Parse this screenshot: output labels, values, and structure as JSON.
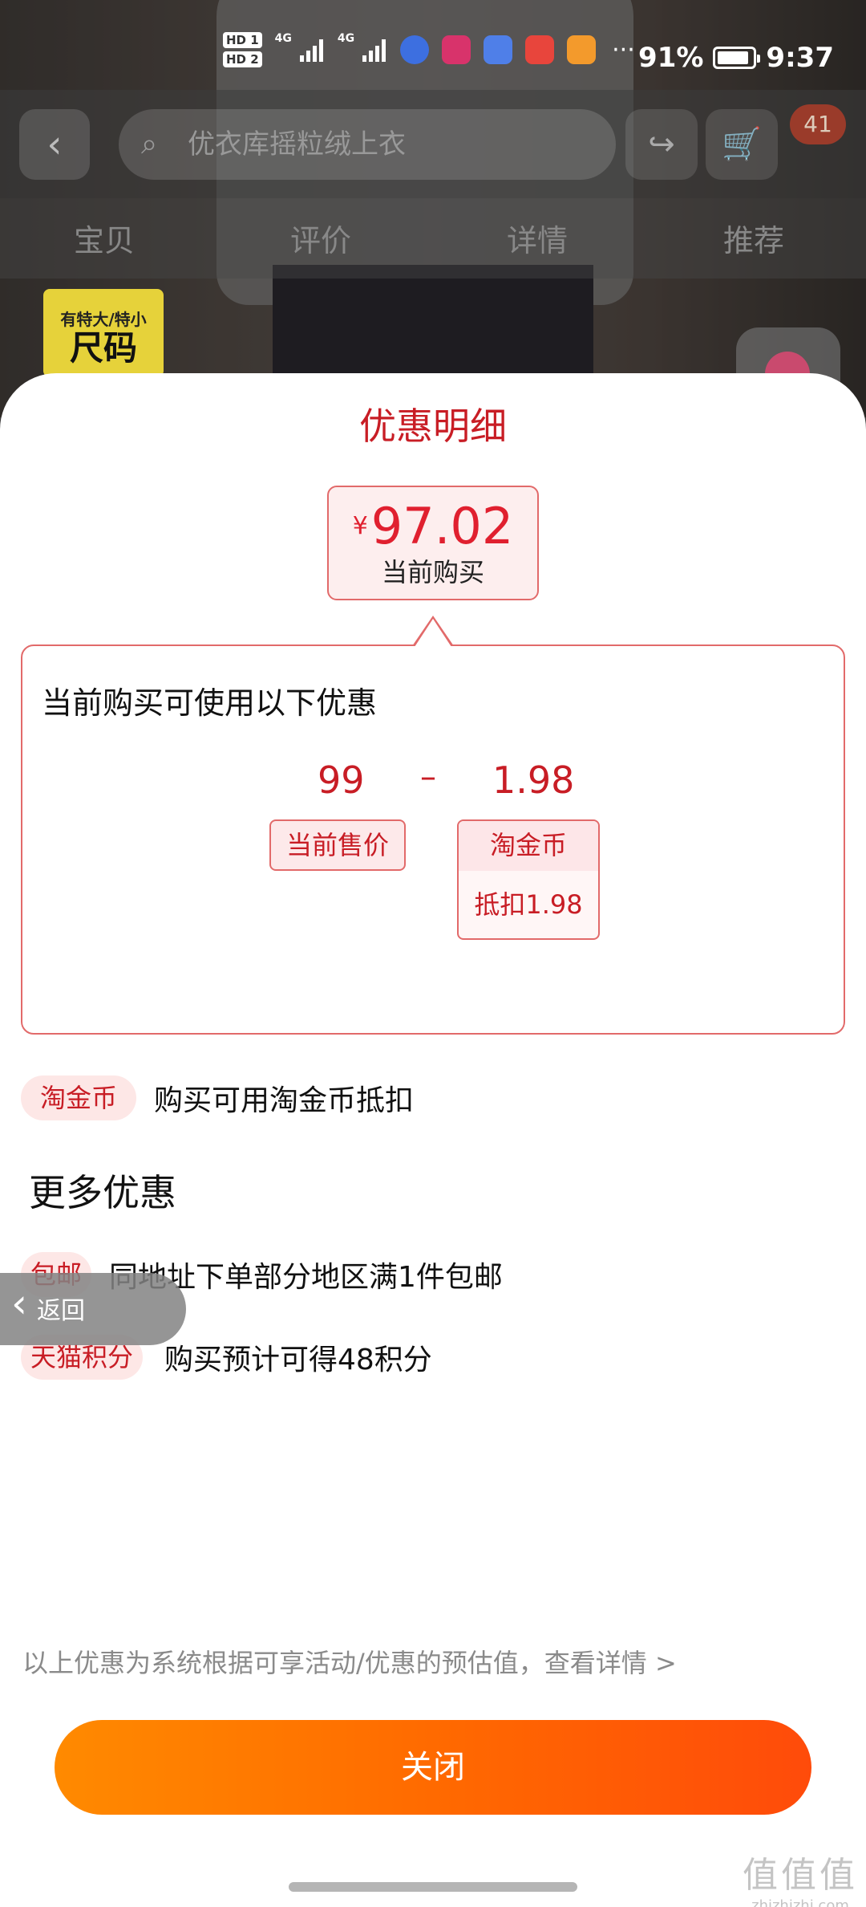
{
  "status_bar": {
    "sim1": "HD 1",
    "sim2": "HD 2",
    "net1": "4G",
    "net2": "4G",
    "battery": "91%",
    "time": "9:37"
  },
  "nav": {
    "search_placeholder": "优衣库摇粒绒上衣",
    "cart_count": "41"
  },
  "tabs": [
    "宝贝",
    "评价",
    "详情",
    "推荐"
  ],
  "size_tag": {
    "line1": "有特大/特小",
    "line2": "尺码"
  },
  "sheet": {
    "title": "优惠明细",
    "price": {
      "currency": "¥",
      "value": "97.02",
      "caption": "当前购买"
    },
    "discount_box": {
      "heading": "当前购买可使用以下优惠",
      "base_value": "99",
      "operator": "–",
      "deduct_value": "1.98",
      "base_tag": "当前售价",
      "coin_tag_title": "淘金币",
      "coin_tag_detail": "抵扣1.98"
    },
    "coin_row": {
      "tag": "淘金币",
      "text": "购买可用淘金币抵扣"
    },
    "more_heading": "更多优惠",
    "more_items": [
      {
        "tag": "包邮",
        "text": "同地址下单部分地区满1件包邮"
      },
      {
        "tag": "天猫积分",
        "text": "购买预计可得48积分"
      }
    ],
    "footnote": "以上优惠为系统根据可享活动/优惠的预估值，查看详情 >",
    "close_label": "关闭"
  },
  "float_back": {
    "label": "返回"
  },
  "watermark": {
    "mark": "值值值",
    "domain": "zhizhizhi.com"
  },
  "colors": {
    "accent_red": "#c81d25",
    "button_orange_start": "#ff8a00",
    "button_orange_end": "#ff4b0a",
    "pill_bg": "#fde7e6"
  }
}
